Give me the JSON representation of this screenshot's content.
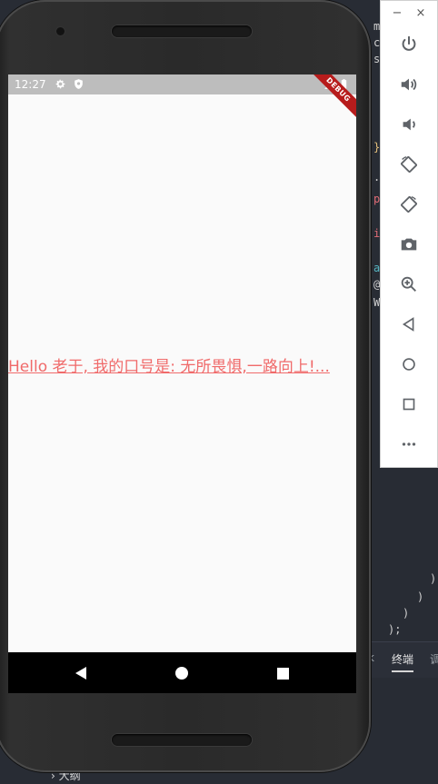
{
  "ide": {
    "code_chars": [
      "m",
      "c",
      "s",
      "}",
      ".",
      "p",
      "i",
      "a",
      "@",
      "W"
    ],
    "closing_lines": [
      ")",
      ")",
      ")",
      ");"
    ],
    "tabs": [
      {
        "label": "k",
        "active": false
      },
      {
        "label": "终端",
        "active": true
      },
      {
        "label": "调",
        "active": false
      }
    ],
    "bottom_label": "大纲"
  },
  "device": {
    "status_time": "12:27",
    "debug_banner": "DEBUG",
    "main_text": "Hello 老于, 我的口号是: 无所畏惧,一路向上!...",
    "text_color": "#f06a6a",
    "nav": [
      "back-triangle-icon",
      "home-circle-icon",
      "overview-square-icon"
    ]
  },
  "emulator_toolbar": {
    "window_controls": [
      "−",
      "×"
    ],
    "buttons": [
      {
        "name": "power-button",
        "icon": "power-icon"
      },
      {
        "name": "volume-up-button",
        "icon": "volume-up-icon"
      },
      {
        "name": "volume-down-button",
        "icon": "volume-down-icon"
      },
      {
        "name": "rotate-left-button",
        "icon": "rotate-left-icon"
      },
      {
        "name": "rotate-right-button",
        "icon": "rotate-right-icon"
      },
      {
        "name": "screenshot-button",
        "icon": "camera-icon"
      },
      {
        "name": "zoom-button",
        "icon": "zoom-in-icon"
      },
      {
        "name": "back-button",
        "icon": "back-icon"
      },
      {
        "name": "home-button",
        "icon": "home-icon"
      },
      {
        "name": "overview-button",
        "icon": "overview-icon"
      },
      {
        "name": "more-button",
        "icon": "more-icon"
      }
    ]
  }
}
